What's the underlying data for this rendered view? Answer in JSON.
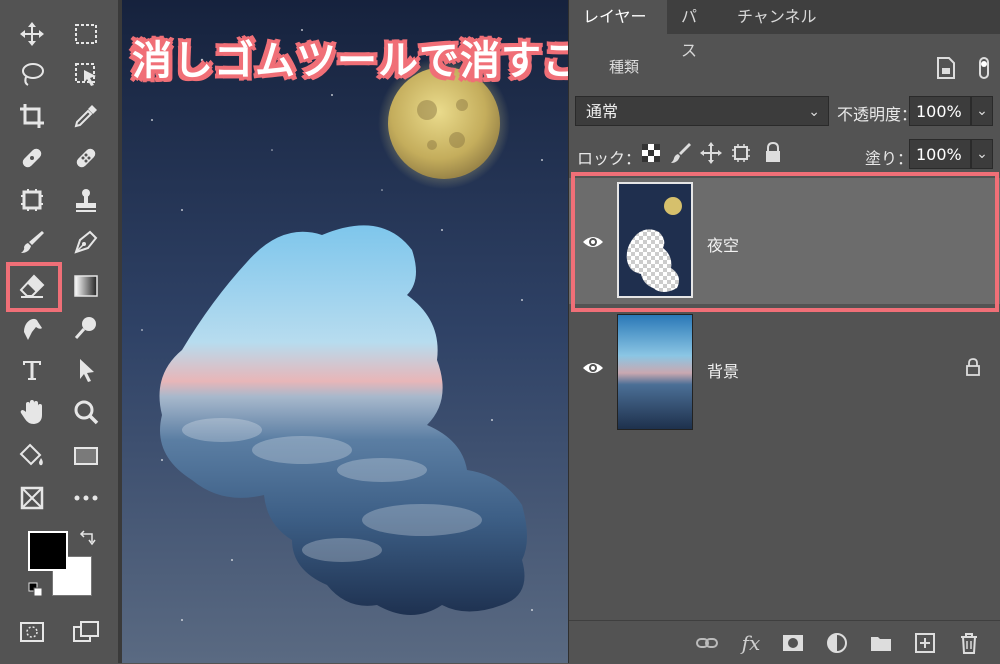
{
  "overlay_title": "消しゴムツールで消すことはできる",
  "tabs": [
    {
      "label": "レイヤー",
      "active": true
    },
    {
      "label": "パス",
      "active": false
    },
    {
      "label": "チャンネル",
      "active": false
    }
  ],
  "kind_label": "種類",
  "blend_mode": "通常",
  "opacity_label": "不透明度：",
  "opacity_value": "100%",
  "lock_label": "ロック：",
  "fill_label": "塗り：",
  "fill_value": "100%",
  "layers": [
    {
      "name": "夜空",
      "selected": true,
      "visible": true,
      "locked": false
    },
    {
      "name": "背景",
      "selected": false,
      "visible": true,
      "locked": true
    }
  ],
  "colors": {
    "highlight": "#f06f77",
    "foreground": "#000000",
    "background": "#ffffff"
  },
  "tools": [
    "move-icon",
    "marquee-icon",
    "lasso-icon",
    "object-select-icon",
    "crop-icon",
    "eyedropper-icon",
    "healing-icon",
    "patch-icon",
    "frame-icon",
    "stamp-icon",
    "brush-icon",
    "pen-icon",
    "eraser-icon",
    "gradient-icon",
    "smudge-icon",
    "dodge-icon",
    "type-icon",
    "path-select-icon",
    "hand-icon",
    "zoom-icon",
    "paint-bucket-icon",
    "rectangle-icon",
    "frame-x-icon",
    "more-icon"
  ],
  "bottom_icons": [
    "link-icon",
    "fx-icon",
    "mask-icon",
    "adjustment-icon",
    "folder-icon",
    "new-layer-icon",
    "trash-icon"
  ]
}
